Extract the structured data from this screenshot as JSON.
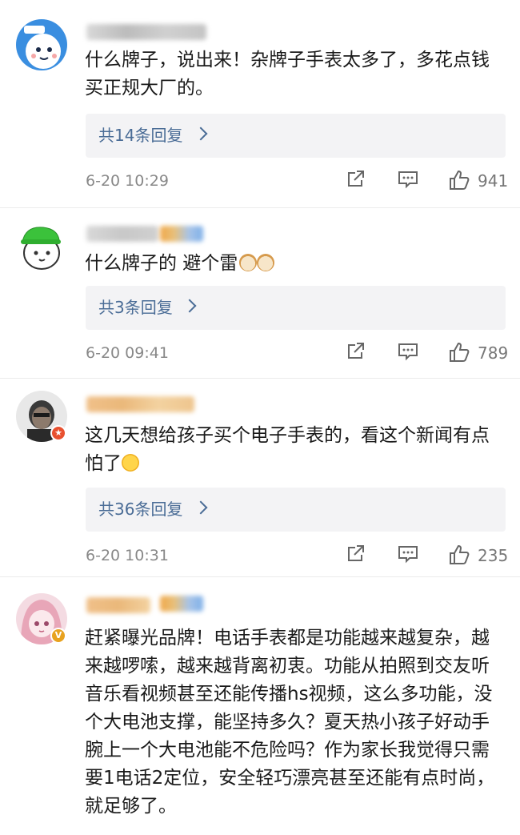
{
  "comments": [
    {
      "text": "什么牌子，说出来！杂牌子手表太多了，多花点钱买正规大厂的。",
      "reply_label": "共14条回复",
      "time": "6-20 10:29",
      "likes": "941",
      "avatar_icon": "cartoon-face-avatar"
    },
    {
      "text": "什么牌子的 避个雷",
      "reply_label": "共3条回复",
      "time": "6-20 09:41",
      "likes": "789",
      "avatar_icon": "green-cap-avatar"
    },
    {
      "text": "这几天想给孩子买个电子手表的，看这个新闻有点怕了",
      "reply_label": "共36条回复",
      "time": "6-20 10:31",
      "likes": "235",
      "avatar_icon": "photo-avatar"
    },
    {
      "text": "赶紧曝光品牌！电话手表都是功能越来越复杂，越来越啰嗦，越来越背离初衷。功能从拍照到交友听音乐看视频甚至还能传播hs视频，这么多功能，没个大电池支撑，能坚持多久？夏天热小孩子好动手腕上一个大电池能不危险吗？作为家长我觉得只需要1电话2定位，安全轻巧漂亮甚至还能有点时尚，就足够了。",
      "avatar_icon": "anime-girl-avatar"
    }
  ],
  "colors": {
    "link": "#4a6c96",
    "reply_bg": "#f3f3f5",
    "meta": "#888888"
  }
}
